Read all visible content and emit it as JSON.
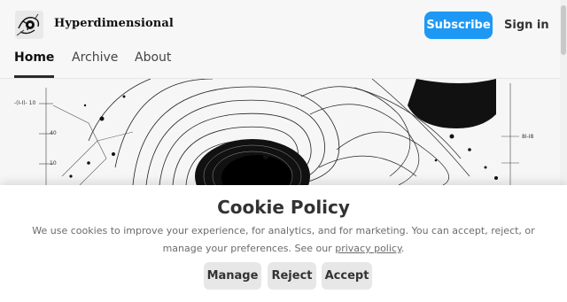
{
  "header": {
    "publication_name": "Hyperdimensional",
    "subscribe_label": "Subscribe",
    "signin_label": "Sign in",
    "accent_color": "#1e98f5"
  },
  "nav": {
    "tabs": [
      {
        "label": "Home",
        "active": true
      },
      {
        "label": "Archive",
        "active": false
      },
      {
        "label": "About",
        "active": false
      }
    ]
  },
  "hero": {
    "annotations": [
      "-(I-I)- 10",
      "8I-I8",
      "40",
      "10"
    ]
  },
  "cookie": {
    "title": "Cookie Policy",
    "text_1": "We use cookies to improve your experience, for analytics, and for marketing. You can accept, reject, or manage your preferences. See our ",
    "link_text": "privacy policy",
    "text_2": ".",
    "buttons": {
      "manage": "Manage",
      "reject": "Reject",
      "accept": "Accept"
    }
  }
}
